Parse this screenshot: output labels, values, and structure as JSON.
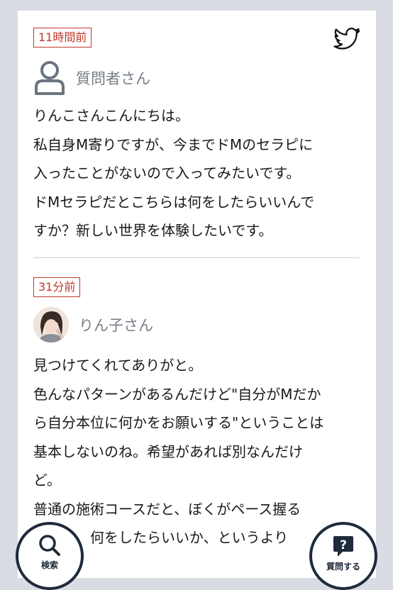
{
  "question": {
    "time": "11時間前",
    "author": "質問者さん",
    "lines": [
      "りんこさんこんにちは。",
      "私自身M寄りですが、今までドMのセラピに",
      "入ったことがないので入ってみたいです。",
      "ドMセラピだとこちらは何をしたらいいんで",
      "すか？新しい世界を体験したいです。"
    ]
  },
  "answer": {
    "time": "31分前",
    "author": "りん子さん",
    "lines": [
      "見つけてくれてありがと。",
      "色んなパターンがあるんだけど\"自分がMだか",
      "ら自分本位に何かをお願いする\"ということは",
      "基本しないのね。希望があれば別なんだけ",
      "ど。",
      "普通の施術コースだと、ぼくがペース握る",
      "　　　　何をしたらいいか、というより"
    ]
  },
  "fab": {
    "search_label": "検索",
    "ask_label": "質問する"
  },
  "colors": {
    "accent": "#c0392b",
    "navy": "#1f2a3a",
    "background": "#d9dce2"
  },
  "icons": [
    "twitter-icon",
    "user-icon",
    "search-icon",
    "question-icon"
  ]
}
